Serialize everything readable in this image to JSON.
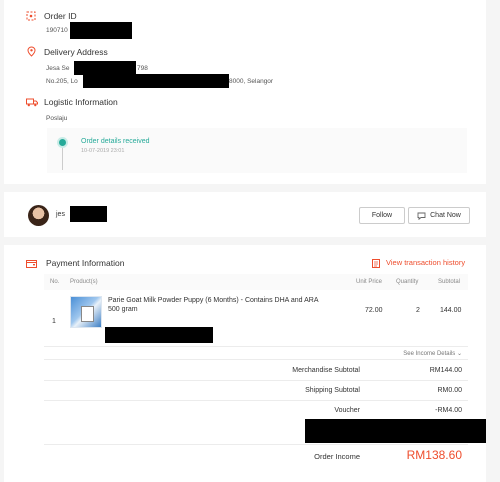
{
  "order": {
    "id_label": "Order ID",
    "id_value": "190710",
    "delivery_label": "Delivery Address",
    "address_name": "Jesa Se",
    "address_name_tail": "798",
    "address_line_start": "No.205, Lo",
    "address_line_end": "8000, Selangor",
    "logistic_label": "Logistic Information",
    "courier": "Poslaju",
    "tracking_status": "Order details received",
    "tracking_time": "10-07-2019 23:01"
  },
  "buyer": {
    "name": "jes",
    "follow_label": "Follow",
    "chat_label": "Chat Now"
  },
  "payment": {
    "title": "Payment Information",
    "history_link": "View transaction history",
    "headers": {
      "no": "No.",
      "products": "Product(s)",
      "unit_price": "Unit Price",
      "quantity": "Quantity",
      "subtotal": "Subtotal"
    },
    "items": [
      {
        "no": "1",
        "name": "Parie Goat Milk Powder Puppy (6 Months) - Contains DHA and ARA 500 gram",
        "unit_price": "72.00",
        "quantity": "2",
        "subtotal": "144.00"
      }
    ],
    "income_details_link": "See Income Details",
    "merch_label": "Merchandise Subtotal",
    "merch_value": "RM144.00",
    "shipping_label": "Shipping Subtotal",
    "shipping_value": "RM0.00",
    "voucher_label": "Voucher",
    "voucher_value": "-RM4.00",
    "income_label": "Order Income",
    "income_value": "RM138.60"
  },
  "colors": {
    "accent": "#ee4d2d",
    "tracking_green": "#26aa99"
  }
}
